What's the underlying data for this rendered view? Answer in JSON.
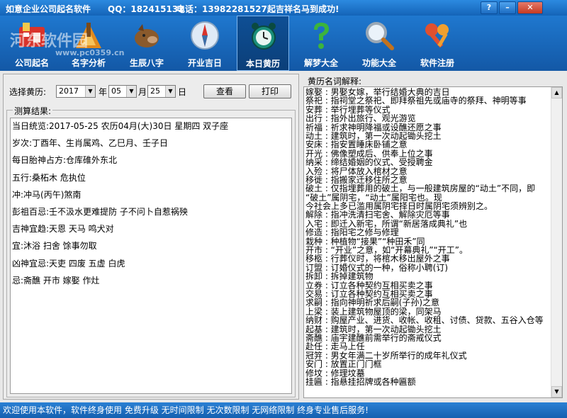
{
  "titlebar": {
    "app_name": "如意企业公司起名软件",
    "qq": "QQ：182415132",
    "phone": "电话：13982281527",
    "slogan": "起吉祥名马到成功!"
  },
  "watermark": {
    "text": "河东软件园",
    "url": "www.pc0359.cn"
  },
  "toolbar": {
    "items": [
      {
        "label": "公司起名",
        "icon": "company-name-icon",
        "color": "#d9332b"
      },
      {
        "label": "名字分析",
        "icon": "name-analysis-icon",
        "color": "#e28a1c"
      },
      {
        "label": "生辰八字",
        "icon": "zodiac-boar-icon",
        "color": "#8a5a2c"
      },
      {
        "label": "开业吉日",
        "icon": "compass-icon",
        "color": "#d8e8f8"
      },
      {
        "label": "本日黄历",
        "icon": "alarm-clock-icon",
        "color": "#1b8f7a"
      },
      {
        "label": "解梦大全",
        "icon": "question-mark-icon",
        "color": "#3cb43c"
      },
      {
        "label": "功能大全",
        "icon": "magnifier-icon",
        "color": "#d0d8e0"
      },
      {
        "label": "软件注册",
        "icon": "keys-icon",
        "color": "#e05030"
      }
    ],
    "active_index": 4
  },
  "query": {
    "label": "选择黄历:",
    "year": "2017",
    "year_unit": "年",
    "month": "05",
    "month_unit": "月",
    "day": "25",
    "day_unit": "日",
    "view_button": "查看",
    "print_button": "打印"
  },
  "result": {
    "title": "测算结果:",
    "lines": [
      "当日统览:2017-05-25   农历04月(大)30日 星期四 双子座",
      "岁次:丁酉年、生肖属鸡、乙巳月、壬子日",
      "每日胎神占方:仓库碓外东北",
      "五行:桑柘木 危执位",
      "冲:冲马(丙午)煞南",
      "彭祖百忌:壬不汲水更难提防 子不问卜自惹祸殃",
      "吉神宜趋:天恩 天马 鸣犬对",
      "宜:沐浴 扫舍 馀事勿取",
      "凶神宜忌:天吏 四废 五虚 白虎",
      "忌:斋醮 开市 嫁娶 作灶"
    ]
  },
  "glossary": {
    "title": "黄历名词解释:",
    "lines": [
      "嫁娶 : 男娶女嫁，举行结婚大典的吉日",
      "祭祀 : 指祠堂之祭祀、即拜祭祖先或庙寺的祭拜、神明等事",
      "安葬 : 举行埋葬等仪式",
      "出行 : 指外出旅行、观光游览",
      "祈福 : 祈求神明降福或设醮还愿之事",
      "动土 : 建筑时，第一次动起锄头挖土",
      "安床 : 指安置睡床卧铺之意",
      "开光 : 佛像塑成后、供奉上位之事",
      "纳采 : 缔结婚姻的仪式、受授聘金",
      "入殓 : 将尸体放入棺材之意",
      "移徙 : 指搬家迁移住所之意",
      "破土 : 仅指埋葬用的破土，与一般建筑房屋的“动土”不同，即",
      "“破土”属阴宅，“动土”属阳宅也。现",
      "今社会上多已滥用属阴宅择日时属阴宅须辨别之。",
      "解除 : 指冲洗清扫宅舍、解除灾厄等事",
      "入宅 : 即迁入新宅，所谓“新居落成典礼”也",
      "修造 : 指阳宅之修与修理",
      "栽种 : 种植物“接果”“种田禾”同",
      "开市 : “开业”之意，如“开幕典礼”“开工”。",
      "移柩 : 行葬仪时，将棺木移出屋外之事",
      "订盟 : 订婚仪式的一种，俗称小聘(订)",
      "拆卸 : 拆掉建筑物",
      "立券 : 订立各种契约互相买卖之事",
      "交易 : 订立各种契约互相买卖之事",
      "求嗣 : 指向神明祈求后嗣(子孙)之意",
      "上梁 : 装上建筑物屋顶的梁，同架马",
      "纳财 : 购屋产业、进货、收帐、收租、讨债、贷款、五谷入仓等",
      "起基 : 建筑时，第一次动起锄头挖土",
      "斋醮 : 庙宇建醮前需举行的斋戒仪式",
      "赴任 : 走马上任",
      "冠笄 : 男女年满二十岁所举行的成年礼仪式",
      "安门 : 放置正门门框",
      "修坟 : 修理坟墓",
      "挂匾 : 指悬挂招牌或各种匾额"
    ]
  },
  "status": {
    "text": "欢迎使用本软件，软件终身使用  免费升级  无时间限制  无次数限制  无网络限制  终身专业售后服务!"
  }
}
